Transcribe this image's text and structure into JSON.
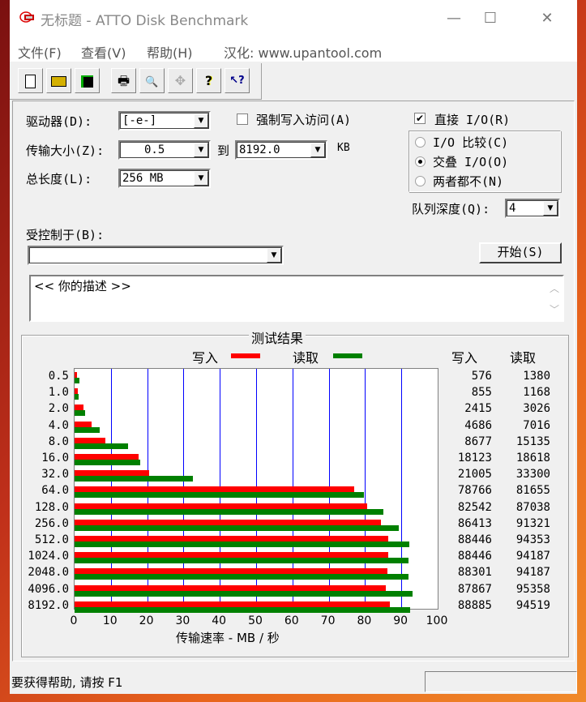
{
  "window": {
    "title": "无标题 - ATTO Disk Benchmark",
    "minimize": "—",
    "maximize": "☐",
    "close": "✕"
  },
  "menu": [
    "文件(F)",
    "查看(V)",
    "帮助(H)",
    "汉化: www.upantool.com"
  ],
  "toolbar": [
    {
      "name": "new-icon",
      "glyph": "🗋"
    },
    {
      "name": "open-icon",
      "glyph": "📂"
    },
    {
      "name": "save-icon",
      "glyph": "💾"
    },
    {
      "name": "print-icon",
      "glyph": "🖶"
    },
    {
      "name": "print-preview-icon",
      "glyph": "🔍"
    },
    {
      "name": "move-icon",
      "glyph": "✥"
    },
    {
      "name": "help-icon",
      "glyph": "?"
    },
    {
      "name": "context-help-icon",
      "glyph": "↖?"
    }
  ],
  "settings": {
    "drive_label": "驱动器(D):",
    "drive_value": "[-e-]",
    "force_write_label": "强制写入访问(A)",
    "force_write_checked": false,
    "direct_io_label": "直接 I/O(R)",
    "direct_io_checked": true,
    "transfer_label": "传输大小(Z):",
    "transfer_from": "0.5",
    "to_label": "到",
    "transfer_to": "8192.0",
    "kb_label": "KB",
    "total_label": "总长度(L):",
    "total_value": "256 MB",
    "radio_options": [
      "I/O 比较(C)",
      "交叠 I/O(O)",
      "两者都不(N)"
    ],
    "radio_selected": 1,
    "queue_label": "队列深度(Q):",
    "queue_value": "4",
    "controlled_label": "受控制于(B):",
    "controlled_value": "",
    "start_button": "开始(S)",
    "description": "<<  你的描述   >>"
  },
  "results": {
    "title": "测试结果",
    "legend_write": "写入",
    "legend_read": "读取",
    "col_write": "写入",
    "col_read": "读取",
    "colors": {
      "write": "#ff0000",
      "read": "#008000",
      "grid": "#0000ff"
    }
  },
  "chart_data": {
    "type": "bar",
    "orientation": "horizontal",
    "title": "测试结果",
    "xlabel": "传输速率 - MB / 秒",
    "ylabel": "",
    "xlim": [
      0,
      100
    ],
    "xticks": [
      "0",
      "10",
      "20",
      "30",
      "40",
      "50",
      "60",
      "70",
      "80",
      "90",
      "100"
    ],
    "grid": true,
    "legend": "top-center",
    "categories": [
      "0.5",
      "1.0",
      "2.0",
      "4.0",
      "8.0",
      "16.0",
      "32.0",
      "64.0",
      "128.0",
      "256.0",
      "512.0",
      "1024.0",
      "2048.0",
      "4096.0",
      "8192.0"
    ],
    "series": [
      {
        "name": "写入",
        "unit": "KB/s",
        "values": [
          576,
          855,
          2415,
          4686,
          8677,
          18123,
          21005,
          78766,
          82542,
          86413,
          88446,
          88446,
          88301,
          87867,
          88885
        ]
      },
      {
        "name": "读取",
        "unit": "KB/s",
        "values": [
          1380,
          1168,
          3026,
          7016,
          15135,
          18618,
          33300,
          81655,
          87038,
          91321,
          94353,
          94187,
          94187,
          95358,
          94519
        ]
      }
    ]
  },
  "status": {
    "text": "要获得帮助, 请按 F1"
  }
}
